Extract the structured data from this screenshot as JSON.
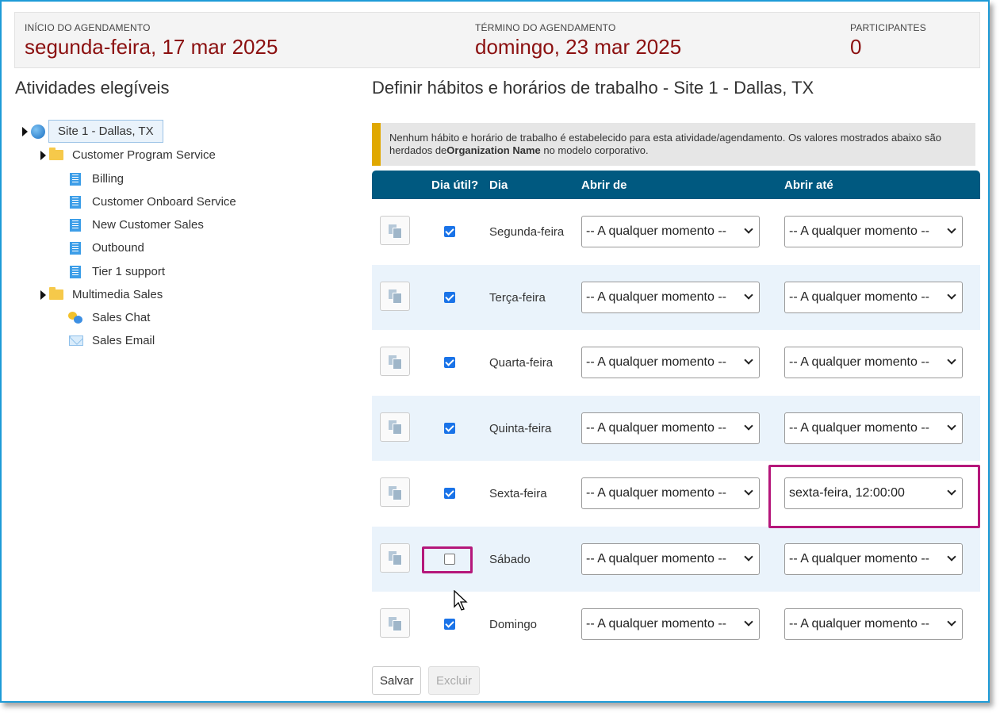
{
  "summary": {
    "start_label": "INÍCIO DO AGENDAMENTO",
    "start_value": "segunda-feira, 17 mar 2025",
    "end_label": "TÉRMINO DO AGENDAMENTO",
    "end_value": "domingo, 23 mar 2025",
    "participants_label": "PARTICIPANTES",
    "participants_value": "0"
  },
  "tree": {
    "title": "Atividades elegíveis",
    "site": "Site 1 - Dallas, TX",
    "groups": [
      {
        "label": "Customer Program Service",
        "items": [
          "Billing",
          "Customer Onboard Service",
          "New Customer Sales",
          "Outbound",
          "Tier 1 support"
        ]
      },
      {
        "label": "Multimedia Sales",
        "items": [
          "Sales Chat",
          "Sales Email"
        ]
      }
    ]
  },
  "panel": {
    "title": "Definir hábitos e horários de trabalho - Site 1 - Dallas, TX",
    "notice_text": "Nenhum hábito e horário de trabalho é estabelecido para esta atividade/agendamento. Os valores mostrados abaixo são herdados de",
    "notice_bold": "Organization Name",
    "notice_tail": " no modelo corporativo.",
    "accent_color": "#e0a800",
    "header_color": "#005980"
  },
  "table": {
    "headers": {
      "workday": "Dia útil?",
      "day": "Dia",
      "open_from": "Abrir de",
      "open_until": "Abrir até"
    },
    "rows": [
      {
        "day": "Segunda-feira",
        "workday": true,
        "from": "-- A qualquer momento --",
        "until": "-- A qualquer momento --"
      },
      {
        "day": "Terça-feira",
        "workday": true,
        "from": "-- A qualquer momento --",
        "until": "-- A qualquer momento --"
      },
      {
        "day": "Quarta-feira",
        "workday": true,
        "from": "-- A qualquer momento --",
        "until": "-- A qualquer momento --"
      },
      {
        "day": "Quinta-feira",
        "workday": true,
        "from": "-- A qualquer momento --",
        "until": "-- A qualquer momento --"
      },
      {
        "day": "Sexta-feira",
        "workday": true,
        "from": "-- A qualquer momento --",
        "until": "sexta-feira, 12:00:00"
      },
      {
        "day": "Sábado",
        "workday": false,
        "from": "-- A qualquer momento --",
        "until": "-- A qualquer momento --"
      },
      {
        "day": "Domingo",
        "workday": true,
        "from": "-- A qualquer momento --",
        "until": "-- A qualquer momento --"
      }
    ]
  },
  "actions": {
    "save": "Salvar",
    "delete": "Excluir"
  }
}
